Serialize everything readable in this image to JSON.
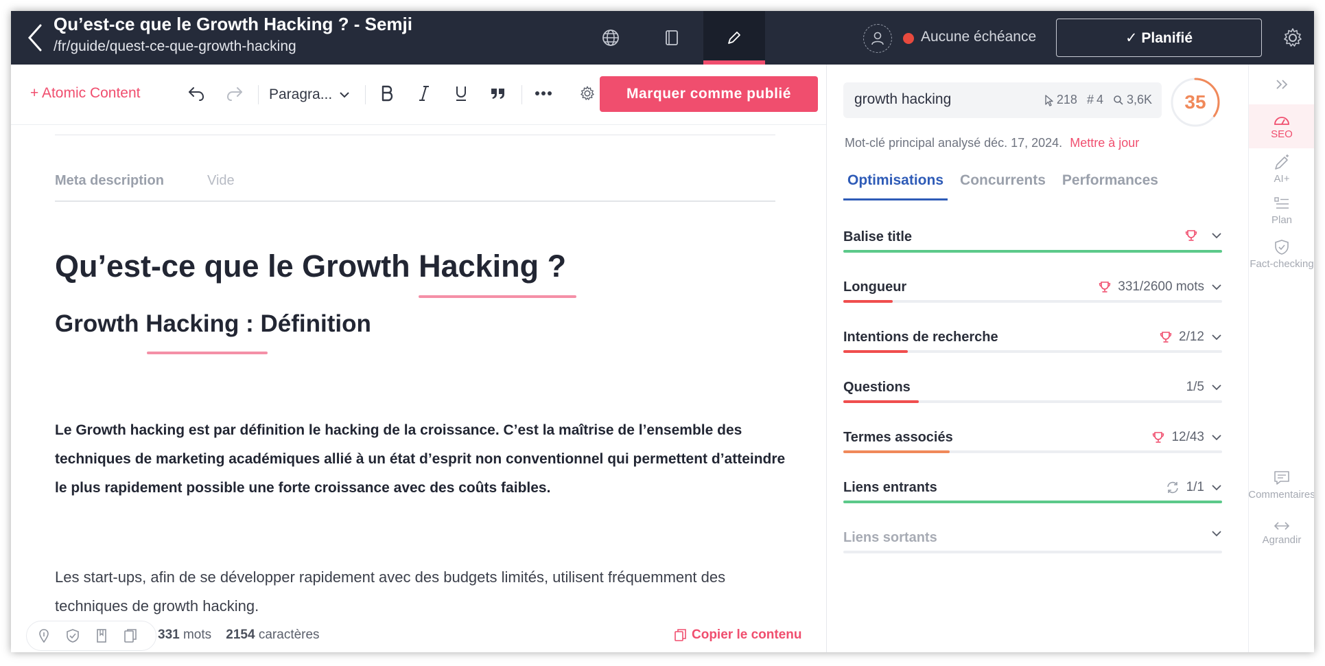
{
  "header": {
    "title": "Qu’est-ce que le Growth Hacking ? - Semji",
    "url": "/fr/guide/quest-ce-que-growth-hacking",
    "deadline": "Aucune échéance",
    "status_label": "✓ Planifié",
    "deadline_color": "#e84a3e"
  },
  "toolbar": {
    "atomic_label": "+ Atomic Content",
    "block_type": "Paragra...",
    "publish_label": "Marquer comme publié",
    "accent_color": "#f04e6e"
  },
  "editor": {
    "meta_label": "Meta description",
    "meta_value": "Vide",
    "h1": "Qu’est-ce que le Growth Hacking ?",
    "h2": "Growth Hacking : Définition",
    "intro": "Le Growth hacking est par définition le hacking de la croissance. C’est la maîtrise de l’ensemble des techniques de marketing académiques allié à un état d’esprit non conventionnel qui permettent d’atteindre le plus rapidement possible une forte croissance avec des coûts faibles.",
    "paragraph": "Les start-ups, afin de se développer rapidement avec des budgets limités, utilisent fréquemment des techniques de growth hacking."
  },
  "footer": {
    "words": "331",
    "words_label": "mots",
    "chars": "2154",
    "chars_label": "caractères",
    "copy_label": "Copier le contenu"
  },
  "seo": {
    "keyword": "growth hacking",
    "clicks": "218",
    "position": "4",
    "volume": "3,6K",
    "score": "35",
    "score_fraction": 0.35,
    "analysis_text": "Mot-clé principal analysé déc. 17, 2024.",
    "analysis_link": "Mettre à jour",
    "tabs": [
      "Optimisations",
      "Concurrents",
      "Performances"
    ],
    "criteria": [
      {
        "label": "Balise title",
        "value": "",
        "icon": "trophy-icon",
        "progress": 1.0,
        "color": "#5cc98a"
      },
      {
        "label": "Longueur",
        "value": "331/2600 mots",
        "icon": "trophy-icon",
        "progress": 0.13,
        "color": "#f04e4e"
      },
      {
        "label": "Intentions de recherche",
        "value": "2/12",
        "icon": "trophy-icon",
        "progress": 0.17,
        "color": "#f04e4e"
      },
      {
        "label": "Questions",
        "value": "1/5",
        "icon": "",
        "progress": 0.2,
        "color": "#f04e4e"
      },
      {
        "label": "Termes associés",
        "value": "12/43",
        "icon": "trophy-icon",
        "progress": 0.28,
        "color": "#f0895a"
      },
      {
        "label": "Liens entrants",
        "value": "1/1",
        "icon": "refresh-icon",
        "progress": 1.0,
        "color": "#5cc98a"
      },
      {
        "label": "Liens sortants",
        "value": "",
        "icon": "",
        "progress": 0,
        "color": "#eceef2"
      }
    ]
  },
  "rail": {
    "seo": "SEO",
    "ai": "AI+",
    "plan": "Plan",
    "fact": "Fact-checking",
    "comments": "Commentaires",
    "expand": "Agrandir"
  }
}
